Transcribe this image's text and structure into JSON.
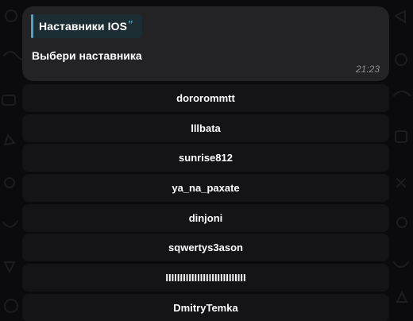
{
  "message": {
    "quote_title": "Наставники IOS",
    "quote_icon": "”",
    "text": "Выбери наставника",
    "time": "21:23"
  },
  "keyboard": {
    "buttons": [
      {
        "label": "dororommtt"
      },
      {
        "label": "lllbata"
      },
      {
        "label": "sunrise812"
      },
      {
        "label": "ya_na_paxate"
      },
      {
        "label": "dinjoni"
      },
      {
        "label": "sqwertys3ason"
      },
      {
        "label": "IIIIIIIIIIIIIIIIIIIIIIIIIIII"
      },
      {
        "label": "DmitryTemka"
      }
    ]
  },
  "colors": {
    "background": "#0b0b0d",
    "bubble": "#232325",
    "accent": "#4aa3c8",
    "button": "#161618",
    "time": "#8e8e93"
  }
}
